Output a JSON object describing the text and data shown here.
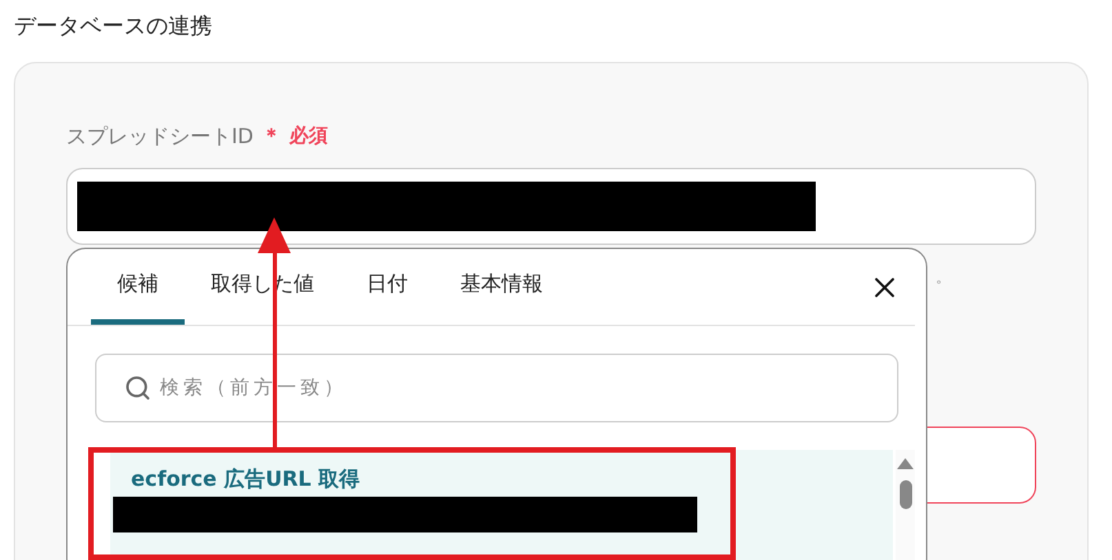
{
  "section_title": "データベースの連携",
  "field": {
    "label": "スプレッドシートID",
    "required_mark": "＊",
    "required_text": "必須"
  },
  "hint_tail": "。",
  "second_field": {
    "error": true
  },
  "popup": {
    "tabs": [
      {
        "label": "候補",
        "selected": true
      },
      {
        "label": "取得した値",
        "selected": false
      },
      {
        "label": "日付",
        "selected": false
      },
      {
        "label": "基本情報",
        "selected": false
      }
    ],
    "search": {
      "placeholder": "検索（前方一致）"
    },
    "items": [
      {
        "title": "ecforce 広告URL 取得",
        "selected": true
      }
    ]
  }
}
